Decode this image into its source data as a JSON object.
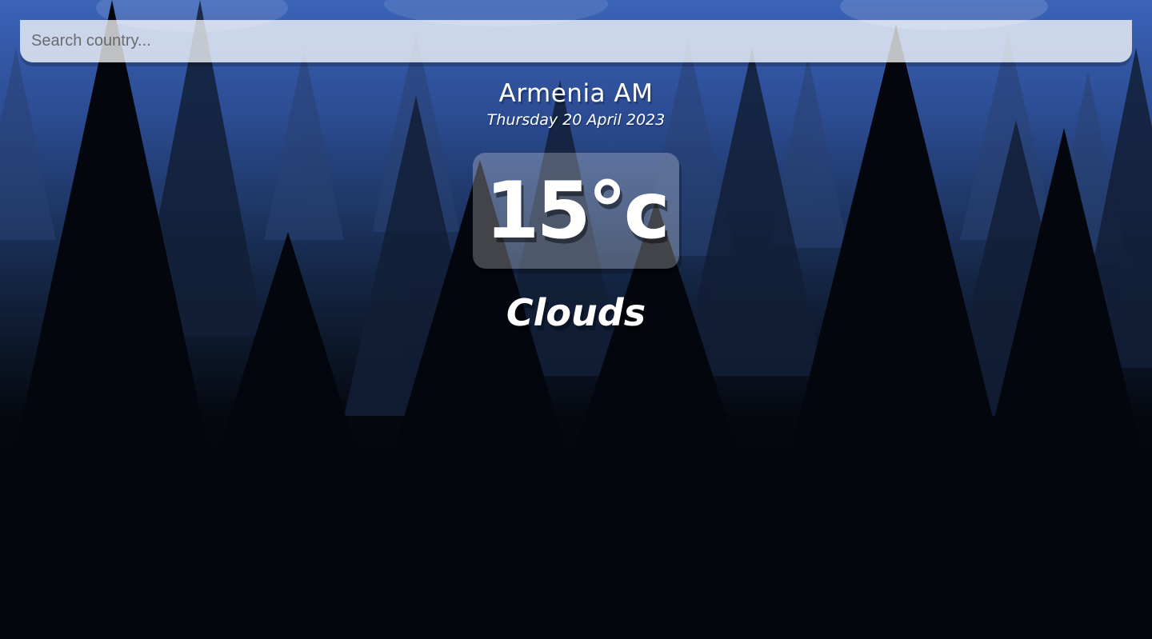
{
  "search": {
    "value": "",
    "placeholder": "Search country..."
  },
  "location": {
    "name": "Armenia AM",
    "date": "Thursday 20 April 2023"
  },
  "weather": {
    "temperature": "15°c",
    "condition": "Clouds"
  },
  "background": {
    "image": "pine-forest-silhouette",
    "sky_color": "#3a63b8",
    "ground_color": "#000000"
  }
}
